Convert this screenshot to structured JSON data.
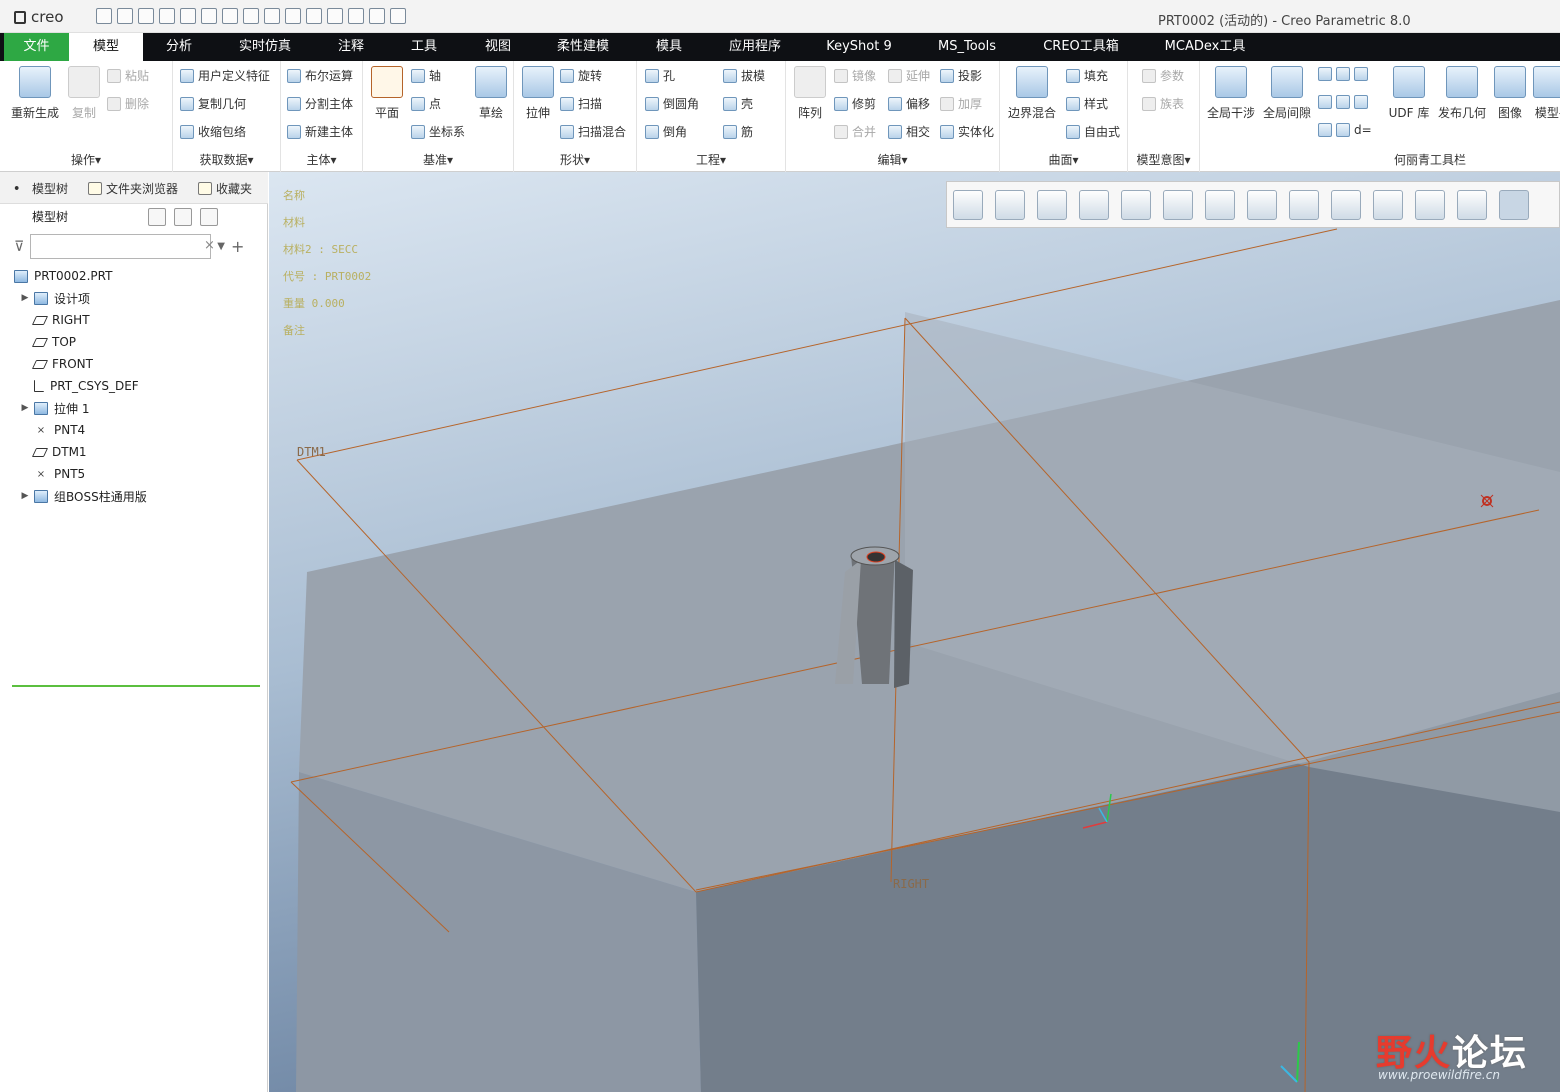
{
  "app": {
    "logo": "creo",
    "window_title": "PRT0002 (活动的) - Creo Parametric 8.0"
  },
  "tabs": [
    {
      "label": "文件"
    },
    {
      "label": "模型"
    },
    {
      "label": "分析"
    },
    {
      "label": "实时仿真"
    },
    {
      "label": "注释"
    },
    {
      "label": "工具"
    },
    {
      "label": "视图"
    },
    {
      "label": "柔性建模"
    },
    {
      "label": "模具"
    },
    {
      "label": "应用程序"
    },
    {
      "label": "KeyShot 9"
    },
    {
      "label": "MS_Tools"
    },
    {
      "label": "CREO工具箱"
    },
    {
      "label": "MCADex工具"
    }
  ],
  "ribbon": {
    "groups": [
      "操作▾",
      "获取数据▾",
      "主体▾",
      "基准▾",
      "形状▾",
      "工程▾",
      "编辑▾",
      "曲面▾",
      "模型意图▾",
      "何丽青工具栏"
    ],
    "regen": "重新生成",
    "copy": "复制",
    "paste": "粘贴",
    "delete": "删除",
    "udf": "用户定义特征",
    "copy_geom": "复制几何",
    "shrinkwrap": "收缩包络",
    "boolean": "布尔运算",
    "split_body": "分割主体",
    "new_body": "新建主体",
    "plane": "平面",
    "axis": "轴",
    "point": "点",
    "csys": "坐标系",
    "sketch": "草绘",
    "extrude": "拉伸",
    "revolve": "旋转",
    "sweep": "扫描",
    "swept_blend": "扫描混合",
    "hole": "孔",
    "round": "倒圆角",
    "chamfer": "倒角",
    "draft": "拔模",
    "shell": "壳",
    "rib": "筋",
    "pattern": "阵列",
    "mirror": "镜像",
    "trim": "修剪",
    "merge": "合并",
    "extend": "延伸",
    "offset": "偏移",
    "intersect": "相交",
    "project": "投影",
    "thicken": "加厚",
    "solidify": "实体化",
    "boundary_blend": "边界混合",
    "fill": "填充",
    "style": "样式",
    "freestyle": "自由式",
    "param": "参数",
    "family": "族表",
    "global_interference": "全局干涉",
    "global_clearance": "全局间隙",
    "d_equals": "d=",
    "udf_lib": "UDF 库",
    "publish_geom": "发布几何",
    "image": "图像",
    "model_trunc": "模型-"
  },
  "panel": {
    "tabs": [
      "模型树",
      "文件夹浏览器",
      "收藏夹"
    ],
    "tree_label": "模型树",
    "search_placeholder": "",
    "items": [
      {
        "label": "PRT0002.PRT",
        "icon": "part-icon",
        "expand": ""
      },
      {
        "label": "设计项",
        "icon": "design-items-icon",
        "expand": "▶"
      },
      {
        "label": "RIGHT",
        "icon": "datum-plane-icon",
        "expand": ""
      },
      {
        "label": "TOP",
        "icon": "datum-plane-icon",
        "expand": ""
      },
      {
        "label": "FRONT",
        "icon": "datum-plane-icon",
        "expand": ""
      },
      {
        "label": "PRT_CSYS_DEF",
        "icon": "csys-icon",
        "expand": ""
      },
      {
        "label": "拉伸 1",
        "icon": "extrude-icon",
        "expand": "▶"
      },
      {
        "label": "PNT4",
        "icon": "datum-point-icon",
        "expand": ""
      },
      {
        "label": "DTM1",
        "icon": "datum-plane-icon",
        "expand": ""
      },
      {
        "label": "PNT5",
        "icon": "datum-point-icon",
        "expand": ""
      },
      {
        "label": "组BOSS柱通用版",
        "icon": "group-icon",
        "expand": "▶"
      }
    ]
  },
  "viewport": {
    "note_lines": [
      "名称",
      "材料",
      "材料2 :    SECC",
      "代号 :   PRT0002",
      "重量  0.000",
      "备注"
    ],
    "labels": {
      "dtm1": "DTM1",
      "right": "RIGHT"
    },
    "watermark_red": "野火",
    "watermark_white": "论坛",
    "watermark_url": "www.proewildfire.cn"
  },
  "colors": {
    "tab_bar": "#0e1014",
    "file_tab": "#2ea844",
    "datum": "#b5642a",
    "bg_top": "#d6e2ee",
    "bg_bottom": "#6f87a4"
  }
}
